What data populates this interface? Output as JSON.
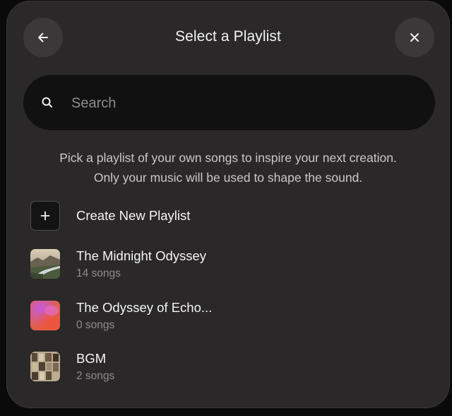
{
  "header": {
    "title": "Select a Playlist",
    "back_icon": "arrow-left-icon",
    "close_icon": "close-icon"
  },
  "search": {
    "placeholder": "Search",
    "value": "",
    "icon": "search-icon"
  },
  "description": {
    "line1": "Pick a playlist of your own songs to inspire your next creation.",
    "line2": "Only your music will be used to shape the sound."
  },
  "create": {
    "label": "Create New Playlist",
    "icon": "plus-icon"
  },
  "playlists": [
    {
      "name": "The Midnight Odyssey",
      "count": "14 songs"
    },
    {
      "name": "The Odyssey of Echo...",
      "count": "0 songs"
    },
    {
      "name": "BGM",
      "count": "2 songs"
    }
  ],
  "colors": {
    "modal_bg": "#2a2828",
    "search_bg": "#121111",
    "button_bg": "#3a3838",
    "text_primary": "#f4f4f4",
    "text_secondary": "#8e8c8c"
  }
}
